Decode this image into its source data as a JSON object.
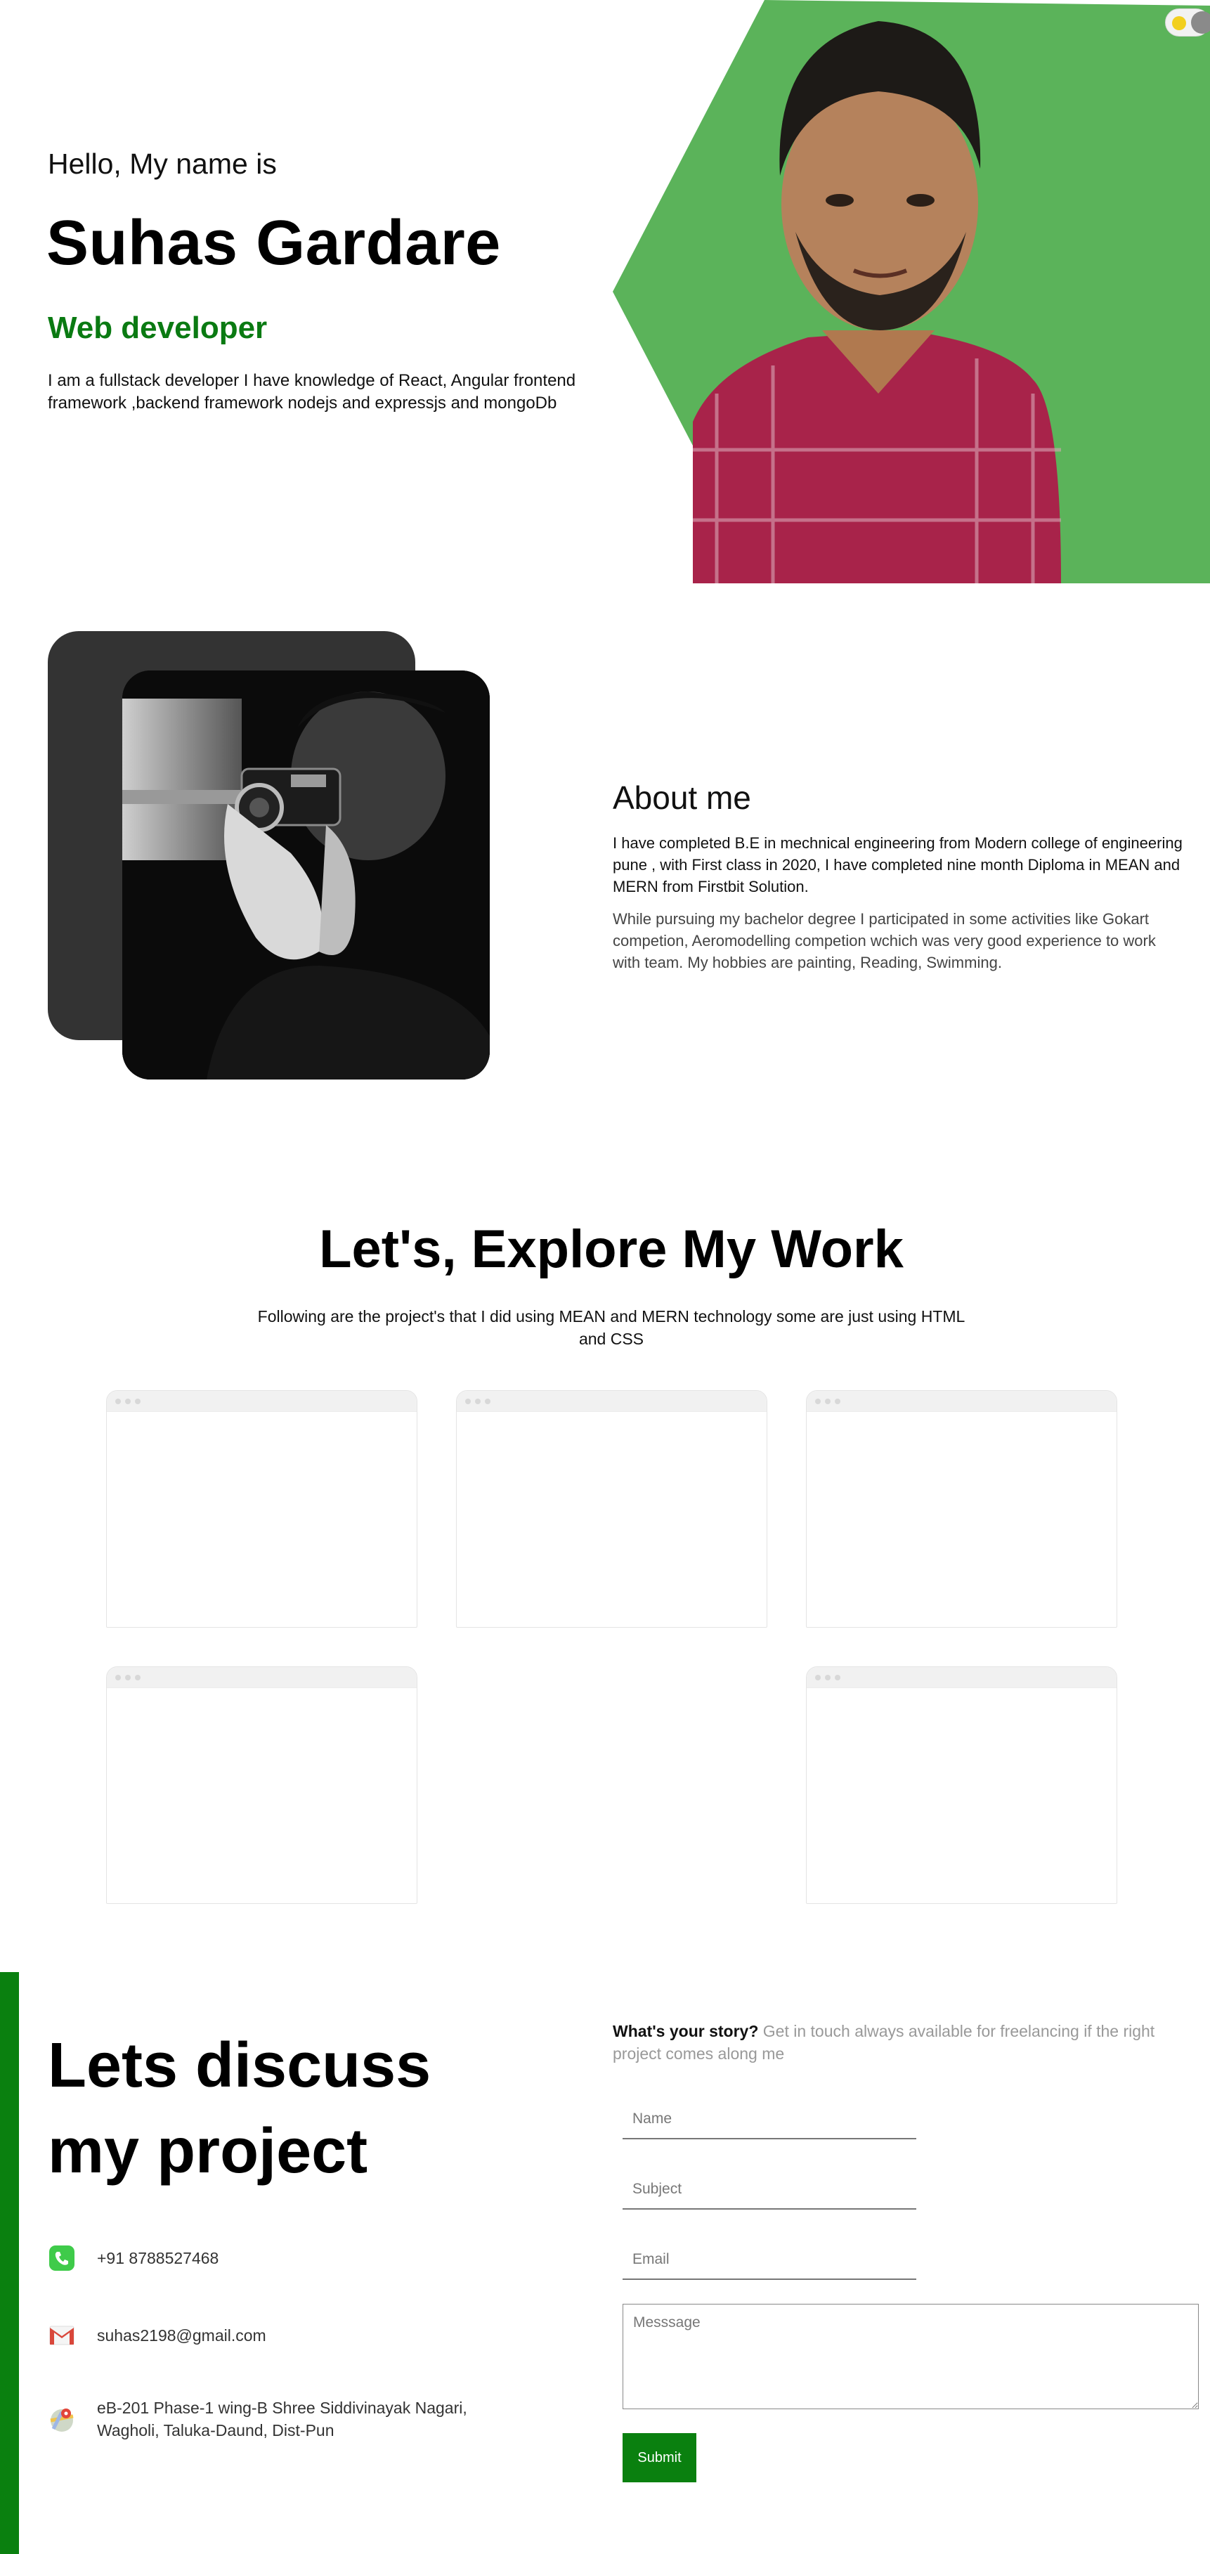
{
  "colors": {
    "accent_green": "#0a800f",
    "hero_green": "#5bb35a",
    "dark_panel": "#333333",
    "role_green": "#0a7a12"
  },
  "theme_toggle": {
    "icon": "sun-icon"
  },
  "hero": {
    "greeting": "Hello, My name is",
    "name": "Suhas Gardare",
    "role": "Web developer",
    "description": "I am a fullstack developer I have knowledge of React, Angular frontend framework ,backend framework nodejs and expressjs and mongoDb"
  },
  "about": {
    "title": "About me",
    "paragraph1": "I have completed B.E in mechnical engineering from Modern college of engineering pune , with First class in 2020, I have completed nine month Diploma in MEAN and MERN from Firstbit Solution.",
    "paragraph2_lines": [
      "While pursuing my bachelor degree I participated in some activities like Gokart",
      "competion, Aeromodelling competion wchich was very good experience to work",
      "with team. My hobbies are painting, Reading, Swimming."
    ]
  },
  "work": {
    "title": "Let's, Explore My Work",
    "subtitle": "Following are the project's that I did using MEAN and MERN technology some are just using HTML and CSS"
  },
  "contact": {
    "title_line1": "Lets discuss",
    "title_line2": "my project",
    "phone": {
      "icon": "phone-icon",
      "text": "+91 8788527468"
    },
    "email": {
      "icon": "gmail-icon",
      "text": "suhas2198@gmail.com"
    },
    "address": {
      "icon": "map-pin-icon",
      "line1": "eB-201 Phase-1 wing-B Shree Siddivinayak Nagari,",
      "line2": "Wagholi, Taluka-Daund, Dist-Pun"
    },
    "story_bold": "What's your story?",
    "story_rest": " Get in touch always available for freelancing if the right project comes along me",
    "form": {
      "name_placeholder": "Name",
      "subject_placeholder": "Subject",
      "email_placeholder": "Email",
      "message_placeholder": "Messsage",
      "submit_label": "Submit"
    }
  }
}
